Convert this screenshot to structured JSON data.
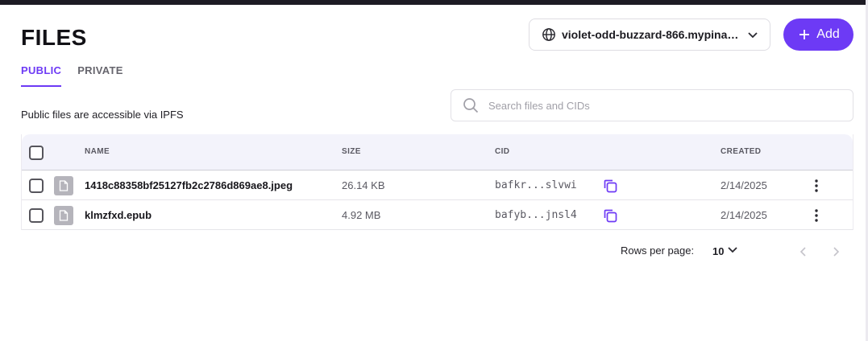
{
  "header": {
    "title": "FILES",
    "gateway": "violet-odd-buzzard-866.mypinata.cloud",
    "add_label": "Add"
  },
  "tabs": [
    {
      "label": "PUBLIC",
      "active": true
    },
    {
      "label": "PRIVATE",
      "active": false
    }
  ],
  "hint": "Public files are accessible via IPFS",
  "search": {
    "placeholder": "Search files and CIDs",
    "value": ""
  },
  "table": {
    "columns": {
      "name": "NAME",
      "size": "SIZE",
      "cid": "CID",
      "created": "CREATED"
    },
    "rows": [
      {
        "name": "1418c88358bf25127fb2c2786d869ae8.jpeg",
        "size": "26.14 KB",
        "cid": "bafkr...slvwi",
        "created": "2/14/2025"
      },
      {
        "name": "klmzfxd.epub",
        "size": "4.92 MB",
        "cid": "bafyb...jnsl4",
        "created": "2/14/2025"
      }
    ]
  },
  "pagination": {
    "rows_per_page_label": "Rows per page:",
    "rows_per_page": "10"
  },
  "colors": {
    "accent": "#6d3af5",
    "header_bg": "#f3f3fb"
  }
}
